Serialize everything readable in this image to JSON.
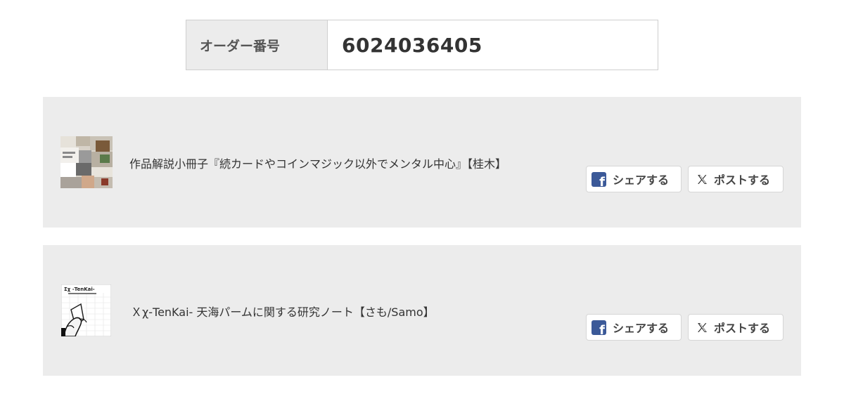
{
  "order": {
    "label": "オーダー番号",
    "number": "6024036405"
  },
  "products": [
    {
      "title": "作品解説小冊子『続カードやコインマジック以外でメンタル中心』【桂木】",
      "thumbnail_icon": "booklet-cover-thumbnail",
      "share_label": "シェアする",
      "post_label": "ポストする"
    },
    {
      "title": "Ｘχ-TenKai- 天海パームに関する研究ノート【さも/Samo】",
      "thumbnail_icon": "notebook-cover-thumbnail",
      "thumbnail_text": "Σχ -TenKai-",
      "share_label": "シェアする",
      "post_label": "ポストする"
    }
  ],
  "colors": {
    "card_background": "#ececec",
    "facebook_blue": "#3b5998"
  }
}
